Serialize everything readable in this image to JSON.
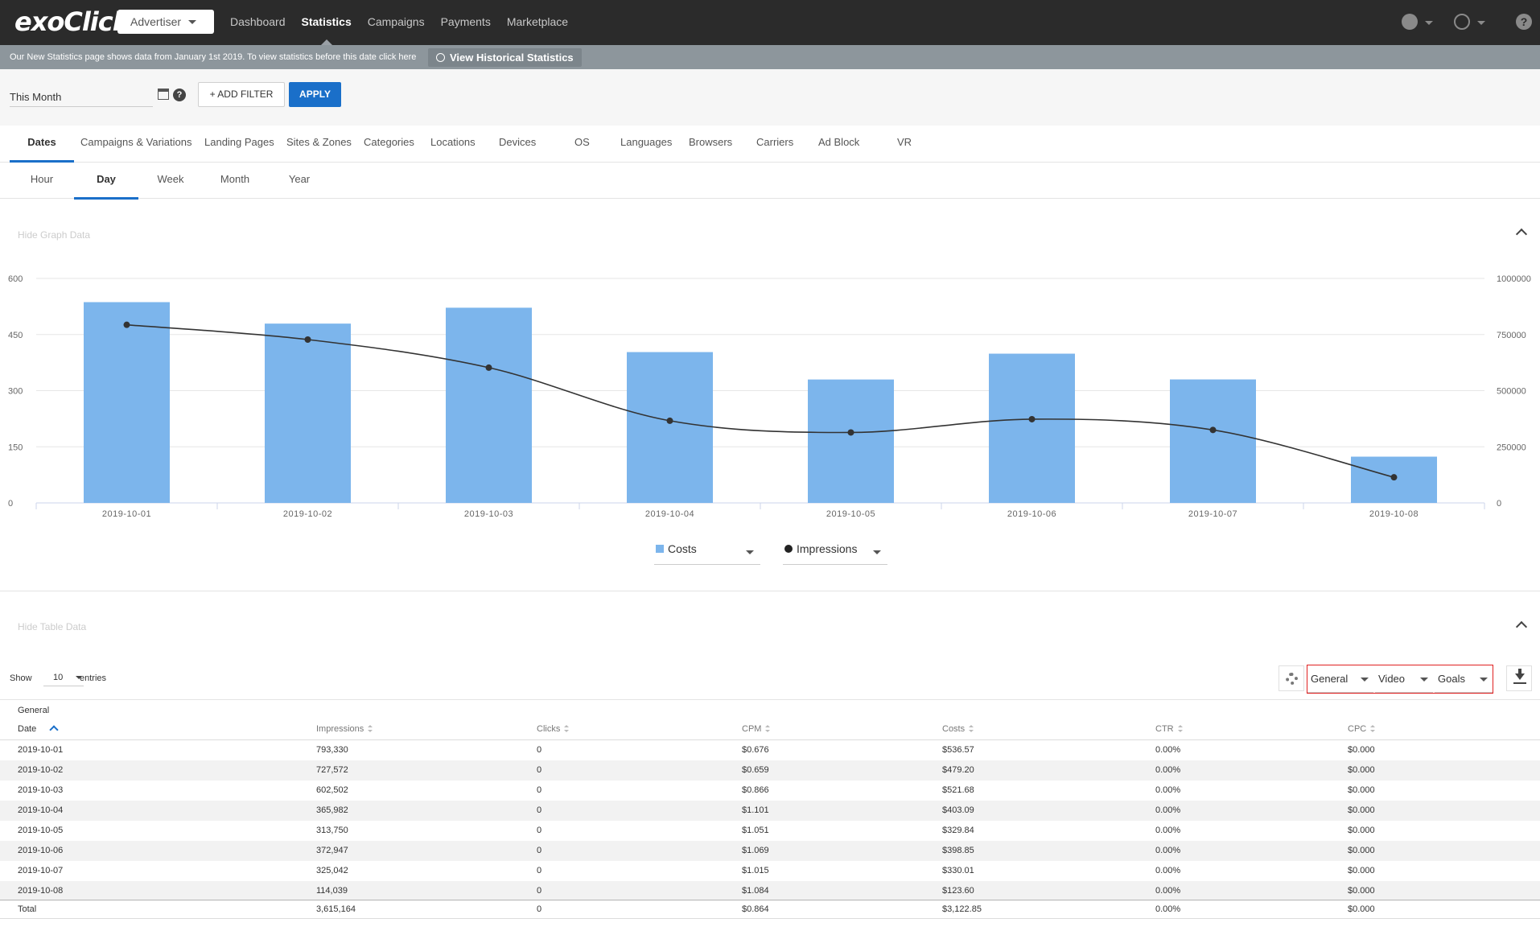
{
  "brand": {
    "logo_text": "exoClick"
  },
  "header": {
    "role": "Advertiser",
    "nav": [
      "Dashboard",
      "Statistics",
      "Campaigns",
      "Payments",
      "Marketplace"
    ],
    "active_nav": "Statistics"
  },
  "notice": {
    "text": "Our New Statistics page shows data from January 1st 2019. To view statistics before this date click here",
    "button": "View Historical Statistics"
  },
  "filters": {
    "date_range": "This Month",
    "help": "?",
    "add_filter_label": "+ ADD FILTER",
    "apply_label": "APPLY"
  },
  "tabs": [
    "Dates",
    "Campaigns & Variations",
    "Landing Pages",
    "Sites & Zones",
    "Categories",
    "Locations",
    "Devices",
    "OS",
    "Languages",
    "Browsers",
    "Carriers",
    "Ad Block",
    "VR"
  ],
  "subtabs": [
    "Hour",
    "Day",
    "Week",
    "Month",
    "Year"
  ],
  "graph": {
    "toggle_label": "Hide Graph Data",
    "metric_left": "Costs",
    "metric_right": "Impressions",
    "colors": {
      "bar": "#7cb5ec",
      "line": "#333333"
    }
  },
  "chart_data": {
    "type": "bar",
    "categories": [
      "2019-10-01",
      "2019-10-02",
      "2019-10-03",
      "2019-10-04",
      "2019-10-05",
      "2019-10-06",
      "2019-10-07",
      "2019-10-08"
    ],
    "series": [
      {
        "name": "Costs",
        "type": "bar",
        "axis": "left",
        "values": [
          536.57,
          479.2,
          521.68,
          403.09,
          329.84,
          398.85,
          330.01,
          123.6
        ]
      },
      {
        "name": "Impressions",
        "type": "line",
        "axis": "right",
        "values": [
          793330,
          727572,
          602502,
          365982,
          313750,
          372947,
          325042,
          114039
        ]
      }
    ],
    "y_left": {
      "ticks": [
        "0",
        "150",
        "300",
        "450",
        "600"
      ],
      "range": [
        0,
        600
      ]
    },
    "y_right": {
      "ticks": [
        "0",
        "250000",
        "500000",
        "750000",
        "1000000"
      ],
      "range": [
        0,
        1000000
      ]
    },
    "grid": true,
    "legend": "bottom"
  },
  "table": {
    "toggle_label": "Hide Table Data",
    "show_label": "Show",
    "entries_value": "10",
    "entries_label": "entries",
    "groups": [
      "General",
      "Video",
      "Goals"
    ],
    "group_label": "General",
    "columns": [
      "Date",
      "Impressions",
      "Clicks",
      "CPM",
      "Costs",
      "CTR",
      "CPC"
    ],
    "rows": [
      [
        "2019-10-01",
        "793,330",
        "0",
        "$0.676",
        "$536.57",
        "0.00%",
        "$0.000"
      ],
      [
        "2019-10-02",
        "727,572",
        "0",
        "$0.659",
        "$479.20",
        "0.00%",
        "$0.000"
      ],
      [
        "2019-10-03",
        "602,502",
        "0",
        "$0.866",
        "$521.68",
        "0.00%",
        "$0.000"
      ],
      [
        "2019-10-04",
        "365,982",
        "0",
        "$1.101",
        "$403.09",
        "0.00%",
        "$0.000"
      ],
      [
        "2019-10-05",
        "313,750",
        "0",
        "$1.051",
        "$329.84",
        "0.00%",
        "$0.000"
      ],
      [
        "2019-10-06",
        "372,947",
        "0",
        "$1.069",
        "$398.85",
        "0.00%",
        "$0.000"
      ],
      [
        "2019-10-07",
        "325,042",
        "0",
        "$1.015",
        "$330.01",
        "0.00%",
        "$0.000"
      ],
      [
        "2019-10-08",
        "114,039",
        "0",
        "$1.084",
        "$123.60",
        "0.00%",
        "$0.000"
      ]
    ],
    "total": [
      "Total",
      "3,615,164",
      "0",
      "$0.864",
      "$3,122.85",
      "0.00%",
      "$0.000"
    ]
  }
}
